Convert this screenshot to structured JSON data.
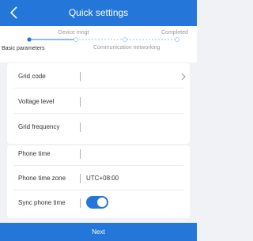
{
  "header": {
    "title": "Quick settings",
    "back_icon": "chevron-left-icon"
  },
  "steps": {
    "items": [
      {
        "label": "Basic parameters",
        "state": "active"
      },
      {
        "label": "Device mngt",
        "state": "pending"
      },
      {
        "label": "Communication networking",
        "state": "pending"
      },
      {
        "label": "Completed",
        "state": "pending"
      }
    ],
    "accent": "#2477d8"
  },
  "section1": {
    "rows": [
      {
        "label": "Grid code",
        "value": "",
        "icon": "chevron-right-icon"
      },
      {
        "label": "Voltage level",
        "value": ""
      },
      {
        "label": "Grid frequency",
        "value": ""
      }
    ]
  },
  "section2": {
    "rows": [
      {
        "label": "Phone time",
        "value": ""
      },
      {
        "label": "Phone time zone",
        "value": "UTC+08:00"
      },
      {
        "label": "Sync phone time",
        "toggle": "on"
      }
    ]
  },
  "footer": {
    "next_label": "Next"
  },
  "colors": {
    "primary": "#2477d8",
    "background": "#f0f2f5"
  }
}
